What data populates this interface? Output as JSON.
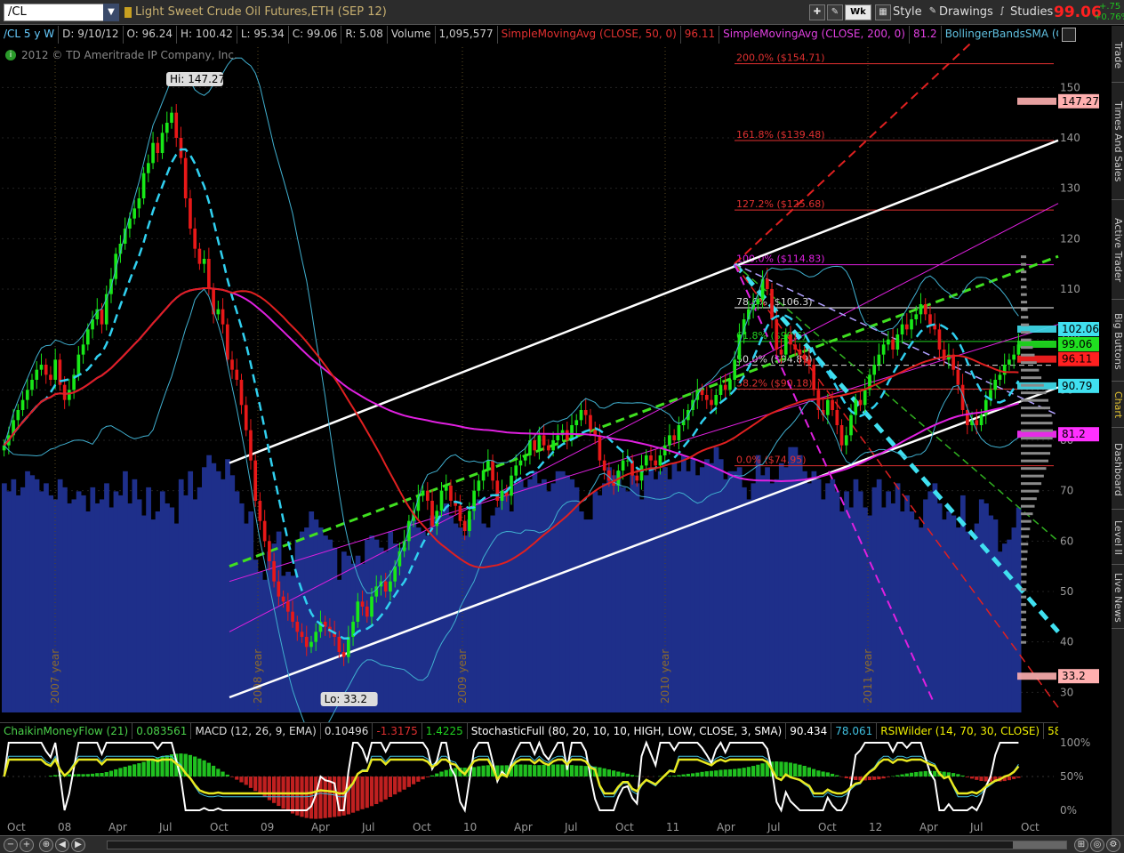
{
  "toolbar": {
    "symbol": "/CL",
    "instrument_title": "Light Sweet Crude Oil Futures,ETH (SEP 12)",
    "period_label": "Wk",
    "style_label": "Style",
    "drawings_label": "Drawings",
    "studies_label": "Studies",
    "last_price": "99.06",
    "change": "+.75",
    "change_pct": "+0.76%"
  },
  "infobar": {
    "symbol_period": "/CL 5 y W",
    "date": "D: 9/10/12",
    "open": "O: 96.24",
    "high": "H: 100.42",
    "low": "L: 95.34",
    "close": "C: 99.06",
    "range": "R: 5.08",
    "volume_label": "Volume",
    "volume_value": "1,095,577",
    "sma50": "SimpleMovingAvg (CLOSE, 50, 0)",
    "sma50_value": "96.11",
    "sma200": "SimpleMovingAvg (CLOSE, 200, 0)",
    "sma200_value": "81.2",
    "bb": "BollingerBandsSMA (CLO..."
  },
  "copyright": "2012 © TD Ameritrade IP Company, Inc.",
  "lower_bar": {
    "cmf": "ChaikinMoneyFlow (21)",
    "cmf_value": "0.083561",
    "macd": "MACD (12, 26, 9, EMA)",
    "macd_v1": "0.10496",
    "macd_v2": "-1.3175",
    "macd_v3": "1.4225",
    "stoch": "StochasticFull (80, 20, 10, 10, HIGH, LOW, CLOSE, 3, SMA)",
    "stoch_v1": "90.434",
    "stoch_v2": "78.061",
    "rsi": "RSIWilder (14, 70, 30, CLOSE)",
    "rsi_value": "58..."
  },
  "side_tabs": [
    "Trade",
    "Times And Sales",
    "Active Trader",
    "Big Buttons",
    "Chart",
    "Dashboard",
    "Level II",
    "Live News"
  ],
  "colors": {
    "up": "#18e818",
    "down": "#e81818",
    "volume": "#1e2f8a",
    "sma50": "#e02020",
    "sma200": "#e020e0",
    "bollinger": "#40b0d0",
    "cyan_ma": "#30d0f0",
    "fib": "#e03030"
  },
  "chart_data": {
    "type": "candlestick",
    "x_labels": [
      "Oct",
      "08",
      "Apr",
      "Jul",
      "Oct",
      "09",
      "Apr",
      "Jul",
      "Oct",
      "10",
      "Apr",
      "Jul",
      "Oct",
      "11",
      "Apr",
      "Jul",
      "Oct",
      "12",
      "Apr",
      "Jul",
      "Oct"
    ],
    "year_markers": [
      "2007 year",
      "2008 year",
      "2009 year",
      "2010 year",
      "2011 year"
    ],
    "y_ticks": [
      30,
      40,
      50,
      60,
      70,
      80,
      90,
      100,
      110,
      120,
      130,
      140,
      150
    ],
    "ylim": [
      26,
      158
    ],
    "annotations": {
      "high": "Hi: 147.27",
      "low": "Lo: 33.2"
    },
    "fib_levels": [
      {
        "label": "200.0%  ($154.71)",
        "price": 154.71
      },
      {
        "label": "161.8%  ($139.48)",
        "price": 139.48
      },
      {
        "label": "127.2%  ($125.68)",
        "price": 125.68
      },
      {
        "label": "100.0%  ($114.83)",
        "price": 114.83
      },
      {
        "label": "78.6%  ($106.3)",
        "price": 106.3
      },
      {
        "label": "61.8%  ($99.6)",
        "price": 99.6
      },
      {
        "label": "50.0%  ($94.89)",
        "price": 94.89
      },
      {
        "label": "38.2%  ($90.18)",
        "price": 90.18
      },
      {
        "label": "0.0%  ($74.95)",
        "price": 74.95
      }
    ],
    "price_markers": [
      {
        "label": "147.27",
        "price": 147.27,
        "color": "#ffb0b0"
      },
      {
        "label": "102.06",
        "price": 102.06,
        "color": "#40e0f0"
      },
      {
        "label": "99.06",
        "price": 99.06,
        "color": "#20e020"
      },
      {
        "label": "96.11",
        "price": 96.11,
        "color": "#ff2020"
      },
      {
        "label": "90.79",
        "price": 90.79,
        "color": "#40e0f0"
      },
      {
        "label": "81.2",
        "price": 81.2,
        "color": "#ff30ff"
      },
      {
        "label": "33.2",
        "price": 33.2,
        "color": "#ffb0b0"
      }
    ],
    "close_weekly": [
      79,
      81,
      84,
      86,
      88,
      90,
      92,
      94,
      95,
      93,
      92,
      96,
      91,
      88,
      90,
      93,
      97,
      99,
      102,
      104,
      106,
      103,
      109,
      112,
      117,
      119,
      122,
      124,
      126,
      128,
      133,
      135,
      139,
      137,
      141,
      143,
      145,
      140,
      136,
      128,
      122,
      118,
      115,
      116,
      110,
      105,
      106,
      103,
      96,
      94,
      92,
      87,
      82,
      76,
      68,
      64,
      60,
      56,
      52,
      49,
      48,
      46,
      44,
      42,
      41,
      39,
      40,
      42,
      44,
      43,
      42,
      41,
      38,
      37,
      41,
      44,
      48,
      47,
      45,
      49,
      51,
      52,
      50,
      52,
      55,
      58,
      60,
      64,
      66,
      69,
      70,
      68,
      63,
      66,
      70,
      71,
      68,
      67,
      64,
      62,
      66,
      70,
      72,
      74,
      76,
      72,
      68,
      70,
      69,
      73,
      75,
      76,
      77,
      80,
      78,
      81,
      79,
      78,
      80,
      81,
      82,
      80,
      83,
      84,
      86,
      85,
      82,
      81,
      76,
      74,
      72,
      71,
      74,
      76,
      76,
      73,
      72,
      75,
      77,
      76,
      75,
      77,
      79,
      81,
      80,
      83,
      84,
      86,
      88,
      90,
      89,
      88,
      87,
      89,
      91,
      90,
      92,
      96,
      101,
      104,
      106,
      107,
      108,
      112,
      110,
      104,
      98,
      97,
      101,
      99,
      98,
      97,
      96,
      95,
      90,
      86,
      85,
      88,
      86,
      83,
      79,
      81,
      85,
      88,
      87,
      90,
      93,
      95,
      97,
      99,
      100,
      98,
      101,
      103,
      102,
      104,
      105,
      107,
      105,
      103,
      102,
      98,
      96,
      97,
      94,
      91,
      86,
      83,
      84,
      83,
      85,
      88,
      90,
      92,
      93,
      95,
      96,
      97,
      99
    ],
    "volume_weekly": [
      57,
      55,
      58,
      54,
      56,
      60,
      59,
      58,
      55,
      57,
      54,
      53,
      58,
      56,
      52,
      53,
      55,
      54,
      50,
      56,
      52,
      53,
      57,
      51,
      55,
      54,
      60,
      52,
      58,
      53,
      49,
      56,
      48,
      50,
      55,
      52,
      51,
      47,
      58,
      54,
      60,
      53,
      56,
      61,
      64,
      62,
      60,
      58,
      63,
      59,
      55,
      52,
      47,
      50,
      38,
      35,
      33,
      40,
      42,
      45,
      34,
      35,
      34,
      43,
      45,
      46,
      50,
      48,
      46,
      44,
      43,
      41,
      33,
      40,
      39,
      37,
      39,
      37,
      43,
      44,
      43,
      41,
      40,
      45,
      42,
      41,
      41,
      47,
      48,
      46,
      45,
      44,
      49,
      48,
      50,
      52,
      49,
      47,
      46,
      44,
      48,
      52,
      53,
      47,
      46,
      49,
      51,
      55,
      54,
      50,
      57,
      58,
      56,
      58,
      60,
      57,
      58,
      55,
      57,
      60,
      60,
      59,
      58,
      56,
      50,
      48,
      48,
      55,
      54,
      57,
      61,
      59,
      60,
      56,
      55,
      59,
      57,
      53,
      59,
      61,
      58,
      60,
      61,
      58,
      62,
      60,
      64,
      60,
      63,
      59,
      61,
      63,
      62,
      66,
      63,
      58,
      60,
      60,
      61,
      56,
      53,
      57,
      64,
      59,
      61,
      57,
      58,
      62,
      61,
      66,
      66,
      64,
      60,
      57,
      60,
      58,
      53,
      57,
      58,
      55,
      50,
      55,
      51,
      58,
      55,
      51,
      49,
      56,
      58,
      51,
      55,
      52,
      57,
      50,
      54,
      50,
      48,
      46,
      53,
      55,
      57,
      52,
      48,
      50,
      49,
      46,
      54,
      45,
      43,
      47,
      53,
      52,
      49,
      48,
      40,
      42,
      43,
      46,
      51
    ],
    "oscillators": {
      "ticks": [
        "100%",
        "50%",
        "0%"
      ]
    }
  }
}
